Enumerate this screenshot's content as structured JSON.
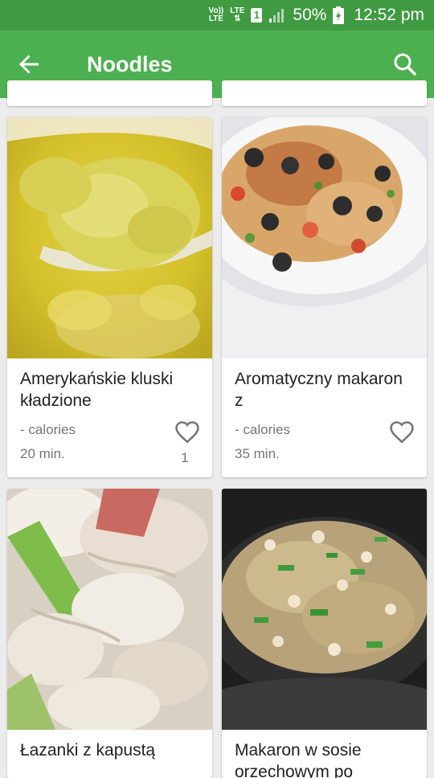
{
  "status_bar": {
    "volte": "Vo))",
    "volte_sub": "LTE",
    "lte": "LTE",
    "sim": "1",
    "battery": "50%",
    "time": "12:52 pm"
  },
  "app_bar": {
    "title": "Noodles"
  },
  "recipes": [
    {
      "title": "Amerykańskie kluski kładzione",
      "calories": "- calories",
      "time": "20 min.",
      "likes": "1"
    },
    {
      "title": "Aromatyczny makaron z",
      "calories": "- calories",
      "time": "35 min.",
      "likes": ""
    },
    {
      "title": "Łazanki z kapustą"
    },
    {
      "title": "Makaron w sosie orzechowym po"
    }
  ],
  "colors": {
    "status_bar": "#3f9a41",
    "app_bar": "#4cb050",
    "background": "#ececec"
  }
}
